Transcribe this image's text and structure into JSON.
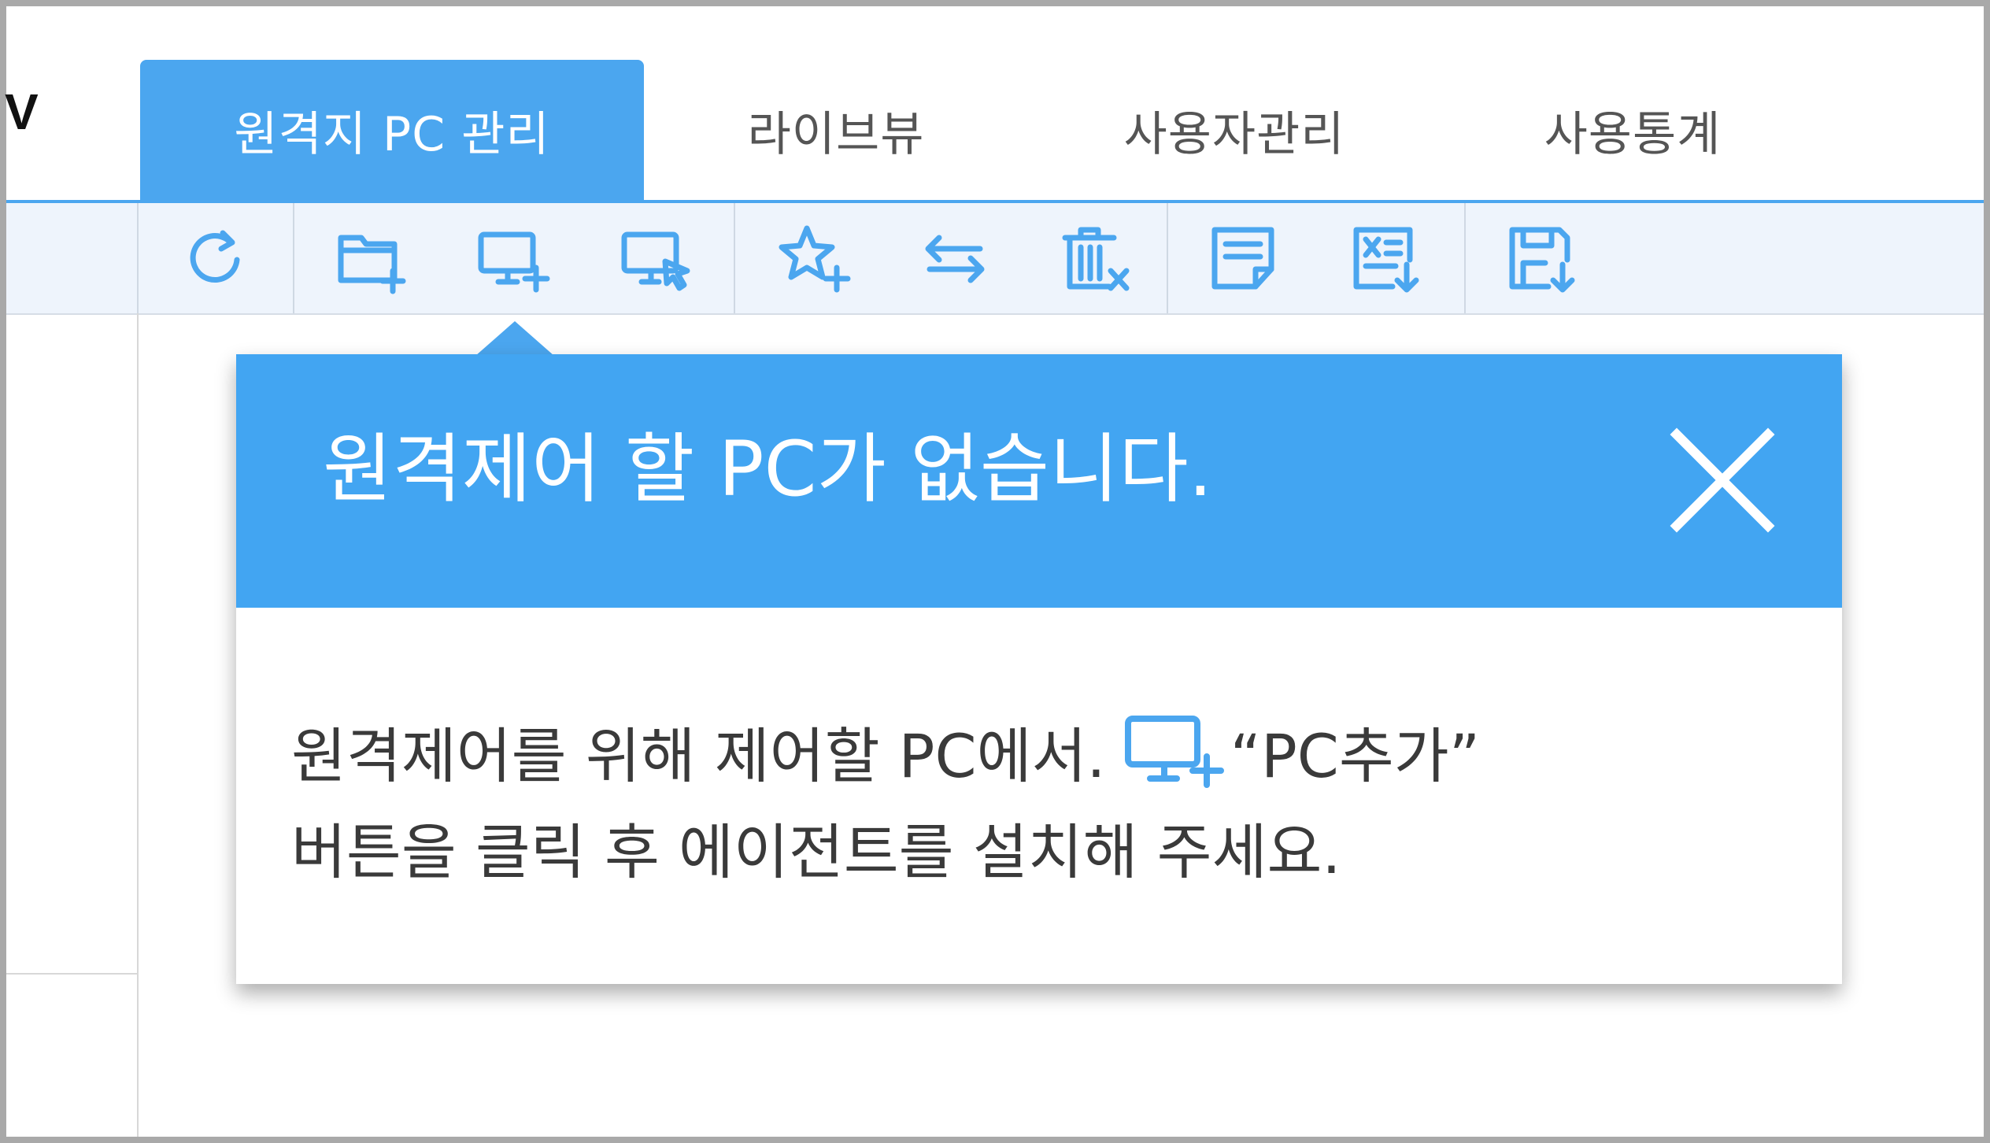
{
  "app": {
    "logo_fragment": "V"
  },
  "tabs": [
    {
      "label": "원격지 PC 관리",
      "active": true
    },
    {
      "label": "라이브뷰",
      "active": false
    },
    {
      "label": "사용자관리",
      "active": false
    },
    {
      "label": "사용통계",
      "active": false
    }
  ],
  "toolbar": {
    "icons": [
      "refresh-icon",
      "folder-add-icon",
      "pc-add-icon",
      "pc-remote-icon",
      "favorite-add-icon",
      "swap-icon",
      "delete-icon",
      "memo-icon",
      "excel-export-icon",
      "save-export-icon"
    ]
  },
  "popup": {
    "title": "원격제어 할 PC가 없습니다.",
    "body_line1_prefix": "원격제어를 위해 제어할 PC에서.",
    "body_line1_suffix": "“PC추가”",
    "body_line2": "버튼을 클릭 후 에이전트를 설치해 주세요.",
    "close_icon": "close-icon",
    "inline_icon": "pc-add-icon"
  },
  "colors": {
    "accent": "#4ba6ef",
    "header": "#42a5f2",
    "toolbar_bg": "#eef4fc"
  }
}
